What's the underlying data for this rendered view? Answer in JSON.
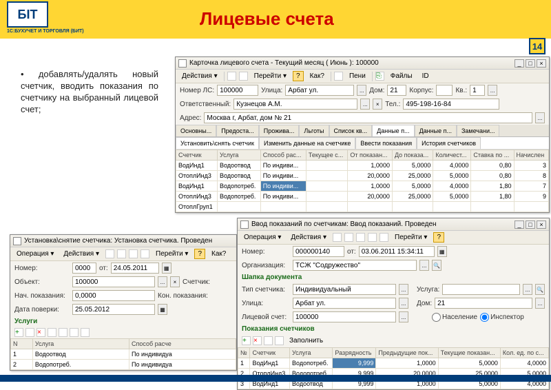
{
  "header": {
    "logo_text": "БІТ",
    "logo_sub": "1С:БУХУЧЕТ И ТОРГОВЛЯ (БИТ)",
    "title": "Лицевые счета",
    "page_number": "14"
  },
  "bullet": "добавлять/удалять новый счетчик, вводить показания по счетчику на выбранный лицевой счет;",
  "win_card": {
    "title": "Карточка лицевого счета - Текущий месяц ( Июнь ): 100000",
    "toolbar": {
      "actions": "Действия ▾",
      "goto": "Перейти ▾",
      "how": "Как?",
      "fines": "Пени",
      "files": "Файлы",
      "id": "ID"
    },
    "f": {
      "nls": "Номер ЛС:",
      "nls_v": "100000",
      "street": "Улица:",
      "street_v": "Арбат ул.",
      "house": "Дом:",
      "house_v": "21",
      "korp": "Корпус:",
      "kv": "Кв.:",
      "kv_v": "1",
      "resp": "Ответственный:",
      "resp_v": "Кузнецов А.М.",
      "tel": "Тел.:",
      "tel_v": "495-198-16-84",
      "addr": "Адрес:",
      "addr_v": "Москва г, Арбат, дом № 21"
    },
    "tabs": [
      "Основны...",
      "Предоста...",
      "Прожива...",
      "Льготы",
      "Список кв...",
      "Данные п...",
      "Данные п...",
      "Замечани..."
    ],
    "subtabs": [
      "Установить\\снять счетчик",
      "Изменить данные на счетчике",
      "Ввести показания",
      "История счетчиков"
    ],
    "cols": [
      "Счетчик",
      "Услуга",
      "Способ рас...",
      "Текущее с...",
      "От показан...",
      "До показа...",
      "Количест...",
      "Ставка по ...",
      "Начислен"
    ],
    "rows": [
      [
        "ВодИнд1",
        "Водоотвод",
        "По индиви...",
        "",
        "1,0000",
        "5,0000",
        "4,0000",
        "0,80",
        "3"
      ],
      [
        "ОтоплИнд3",
        "Водоотвод",
        "По индиви...",
        "",
        "20,0000",
        "25,0000",
        "5,0000",
        "0,80",
        "8"
      ],
      [
        "ВодИнд1",
        "Водопотреб.",
        "По индиви...",
        "",
        "1,0000",
        "5,0000",
        "4,0000",
        "1,80",
        "7"
      ],
      [
        "ОтоплИнд3",
        "Водопотреб.",
        "По индиви...",
        "",
        "20,0000",
        "25,0000",
        "5,0000",
        "1,80",
        "9"
      ],
      [
        "ОтоплГруп1",
        "",
        "",
        "",
        "",
        "",
        "",
        "",
        ""
      ]
    ]
  },
  "win_install": {
    "title": "Установка\\снятие счетчика: Установка счетчика. Проведен",
    "toolbar": {
      "op": "Операция ▾",
      "actions": "Действия ▾",
      "goto": "Перейти ▾",
      "how": "Как?"
    },
    "f": {
      "num": "Номер:",
      "num_v": "0000",
      "from": "от:",
      "from_v": "24.05.2011",
      "obj": "Объект:",
      "obj_v": "100000",
      "meter": "Счетчик:",
      "start": "Нач. показания:",
      "start_v": "0,0000",
      "end": "Кон. показания:",
      "check": "Дата поверки:",
      "check_v": "25.05.2012"
    },
    "serv_title": "Услуги",
    "cols": [
      "N",
      "Услуга",
      "Способ расче"
    ],
    "rows": [
      [
        "1",
        "Водоотвод",
        "По индивидуа"
      ],
      [
        "2",
        "Водопотреб.",
        "По индивидуа"
      ]
    ]
  },
  "win_input": {
    "title": "Ввод показаний по счетчикам: Ввод показаний. Проведен",
    "toolbar": {
      "op": "Операция ▾",
      "actions": "Действия ▾",
      "goto": "Перейти ▾",
      "fill": "Заполнить"
    },
    "f": {
      "num": "Номер:",
      "num_v": "000000140",
      "from": "от:",
      "from_v": "03.06.2011 15:34:11",
      "org": "Организация:",
      "org_v": "ТСЖ \"Содружество\"",
      "hdr": "Шапка документа",
      "type": "Тип счетчика:",
      "type_v": "Индивидуальный",
      "serv": "Услуга:",
      "street": "Улица:",
      "street_v": "Арбат ул.",
      "house": "Дом:",
      "house_v": "21",
      "acc": "Лицевой счет:",
      "acc_v": "100000",
      "pop": "Население",
      "insp": "Инспектор"
    },
    "readings_title": "Показания счетчиков",
    "cols": [
      "№",
      "Счетчик",
      "Услуга",
      "Разрядность",
      "Предыдущие пок...",
      "Текущие показан...",
      "Кол. ед. по с..."
    ],
    "rows": [
      [
        "1",
        "ВодИнд1",
        "Водопотреб.",
        "9,999",
        "1,0000",
        "5,0000",
        "4,0000"
      ],
      [
        "2",
        "ОтоплИнд3",
        "Водопотреб.",
        "9,999",
        "20,0000",
        "25,0000",
        "5,0000"
      ],
      [
        "3",
        "ВодИнд1",
        "Водоотвод",
        "9,999",
        "1,0000",
        "5,0000",
        "4,0000"
      ]
    ]
  }
}
